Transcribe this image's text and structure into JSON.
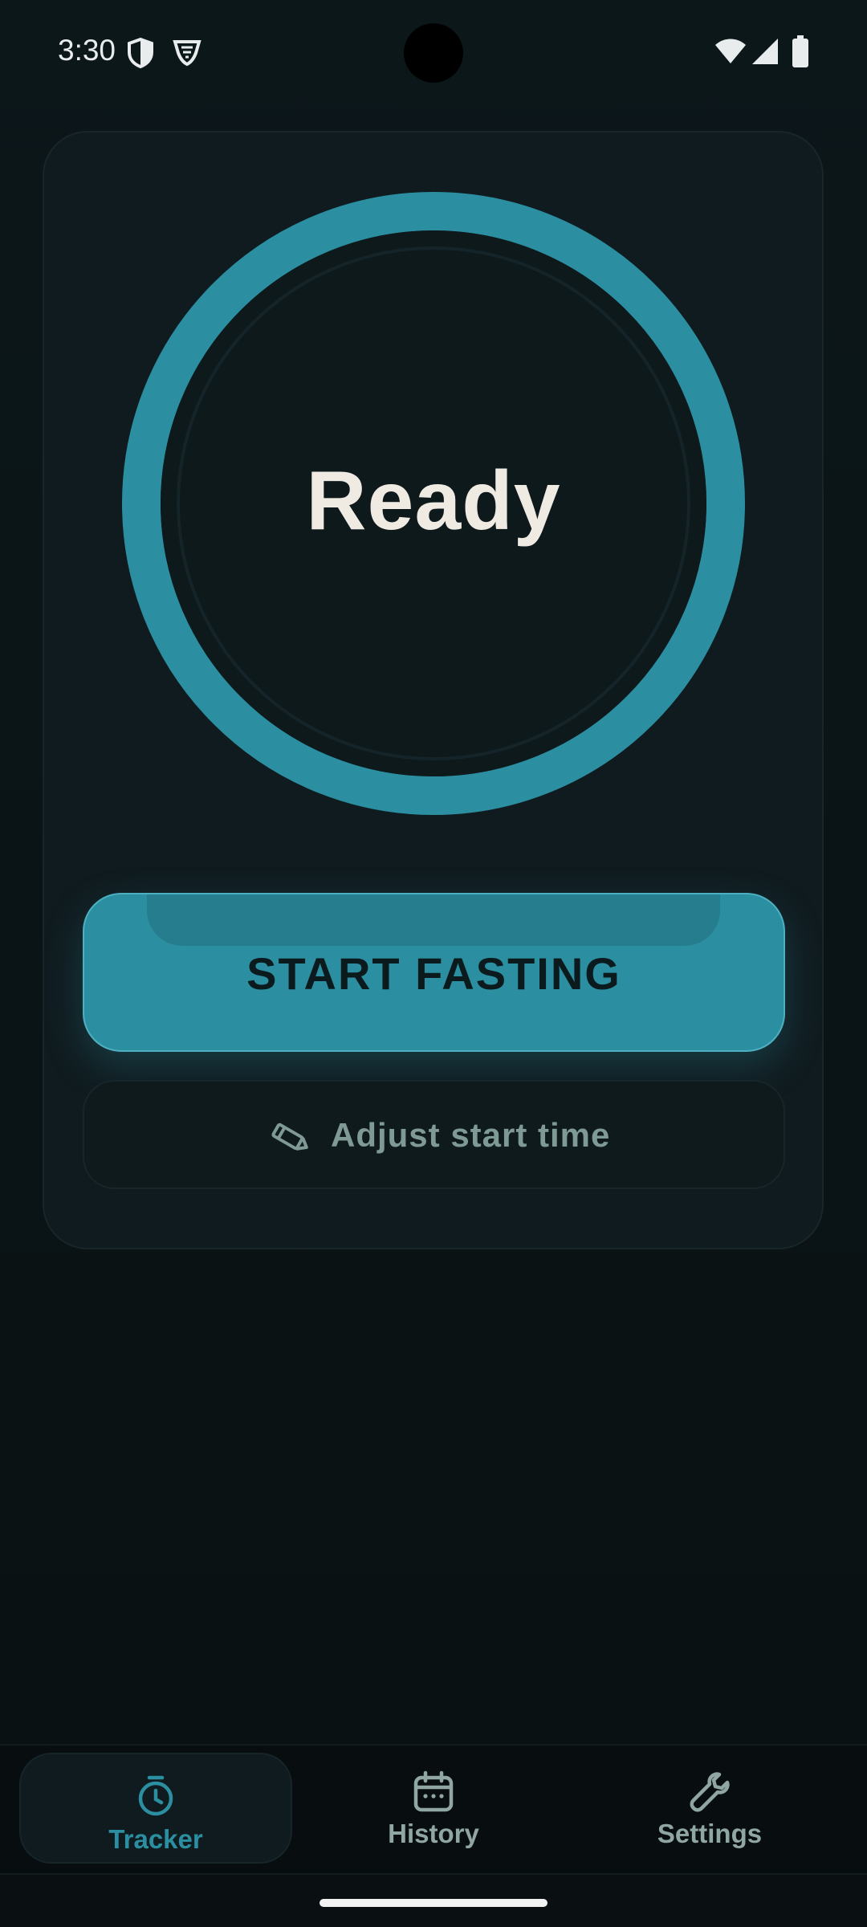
{
  "status_bar": {
    "time": "3:30",
    "icons": [
      "shield-icon",
      "vpn-shield-icon",
      "wifi-icon",
      "cell-signal-icon",
      "battery-icon"
    ]
  },
  "tracker": {
    "status_label": "Ready",
    "progress": 1.0,
    "ring_color": "#2b8fa1",
    "start_button_label": "START FASTING",
    "adjust_button_label": "Adjust start time",
    "adjust_icon": "pencil-icon"
  },
  "nav": {
    "items": [
      {
        "label": "Tracker",
        "icon": "stopwatch-icon",
        "active": true
      },
      {
        "label": "History",
        "icon": "calendar-icon",
        "active": false
      },
      {
        "label": "Settings",
        "icon": "wrench-icon",
        "active": false
      }
    ]
  },
  "colors": {
    "accent": "#2b8fa1",
    "background": "#0a1214",
    "card": "#101b1f",
    "text_primary": "#efeae2",
    "text_muted": "#7f9995"
  }
}
